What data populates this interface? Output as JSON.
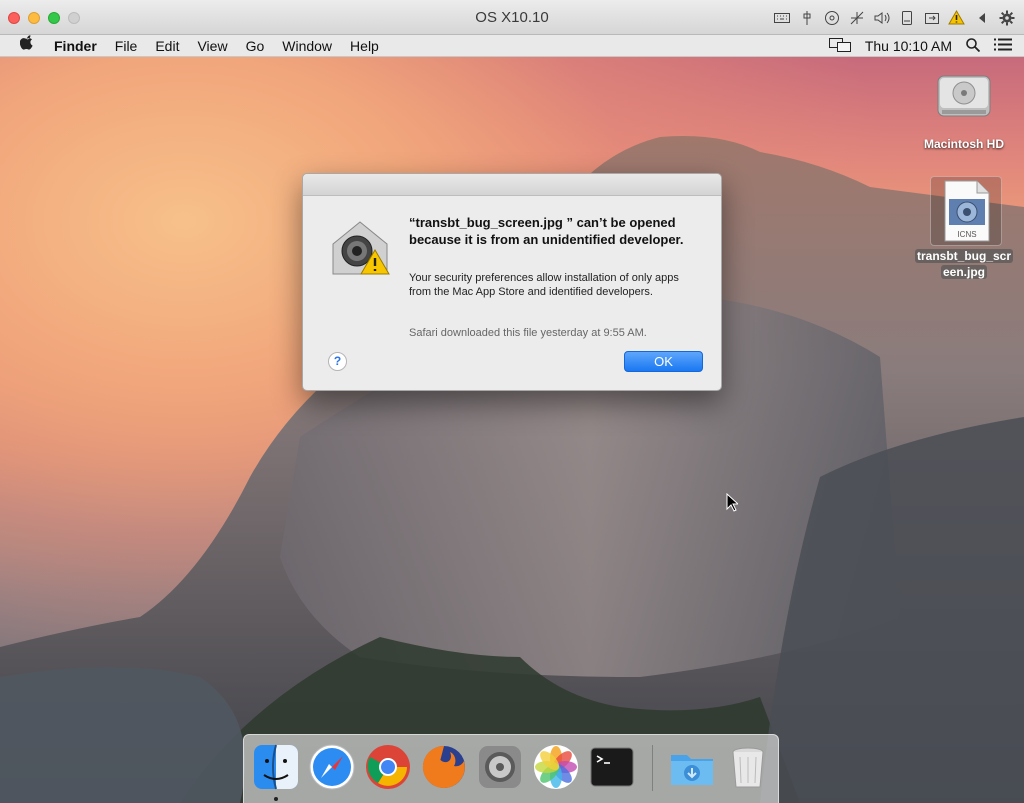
{
  "vm_window": {
    "title": "OS X10.10",
    "toolbar_icons": [
      "keyboard-icon",
      "usb-icon",
      "cd-icon",
      "network-icon",
      "sound-icon",
      "device-icon",
      "shared-folder-icon",
      "warning-icon",
      "left-arrow-icon",
      "settings-gear-icon"
    ]
  },
  "menubar": {
    "apple": "",
    "items": [
      "Finder",
      "File",
      "Edit",
      "View",
      "Go",
      "Window",
      "Help"
    ],
    "clock": "Thu 10:10 AM"
  },
  "desktop": {
    "drive_label": "Macintosh HD",
    "file_label_line1": "transbt_bug_scr",
    "file_label_line2": "een.jpg",
    "file_type_tag": "ICNS"
  },
  "dialog": {
    "title": "“transbt_bug_screen.jpg ” can’t be opened because it is from an unidentified developer.",
    "body": "Your security preferences allow installation of only apps from the Mac App Store and identified developers.",
    "note": "Safari downloaded this file yesterday at 9:55 AM.",
    "help_label": "?",
    "ok_label": "OK"
  },
  "dock": {
    "apps": [
      "finder",
      "safari",
      "chrome",
      "firefox",
      "system-preferences",
      "photos",
      "terminal",
      "downloads",
      "trash"
    ]
  },
  "colors": {
    "ok_button": "#1a78f2",
    "close": "#fc605c",
    "minimize": "#fdbc40",
    "maximize": "#34c84a"
  }
}
